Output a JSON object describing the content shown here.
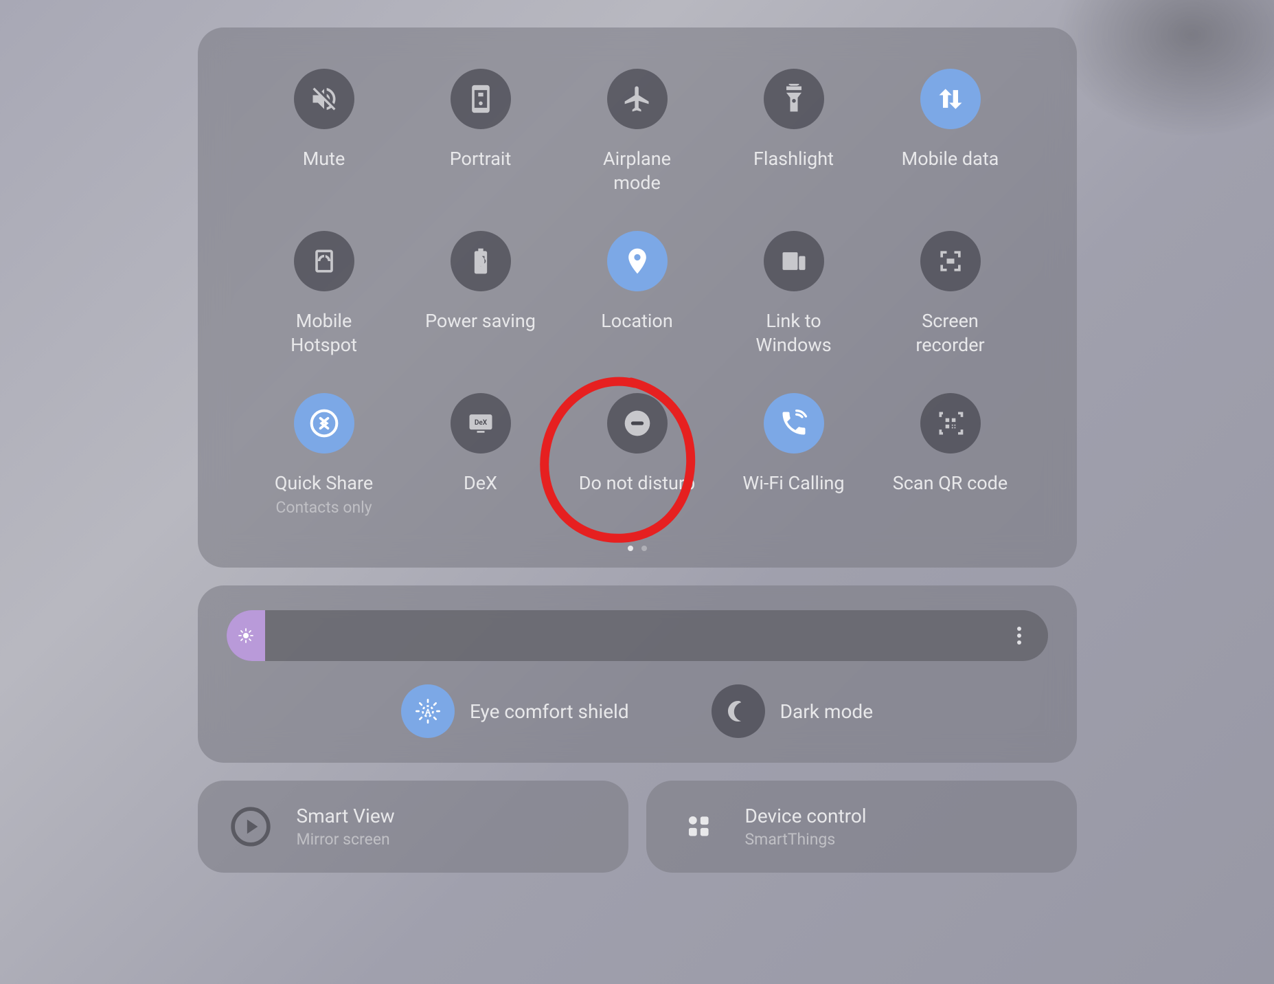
{
  "tiles": [
    {
      "label": "Mute",
      "active": false,
      "icon": "mute"
    },
    {
      "label": "Portrait",
      "active": false,
      "icon": "portrait"
    },
    {
      "label": "Airplane mode",
      "active": false,
      "icon": "airplane"
    },
    {
      "label": "Flashlight",
      "active": false,
      "icon": "flashlight"
    },
    {
      "label": "Mobile data",
      "active": true,
      "icon": "mobile-data"
    },
    {
      "label": "Mobile Hotspot",
      "active": false,
      "icon": "hotspot"
    },
    {
      "label": "Power saving",
      "active": false,
      "icon": "power-saving"
    },
    {
      "label": "Location",
      "active": true,
      "icon": "location"
    },
    {
      "label": "Link to Windows",
      "active": false,
      "icon": "link-windows"
    },
    {
      "label": "Screen recorder",
      "active": false,
      "icon": "screen-recorder"
    },
    {
      "label": "Quick Share",
      "sublabel": "Contacts only",
      "active": true,
      "icon": "quick-share"
    },
    {
      "label": "DeX",
      "active": false,
      "icon": "dex"
    },
    {
      "label": "Do not disturb",
      "active": false,
      "icon": "dnd",
      "annotated": true
    },
    {
      "label": "Wi-Fi Calling",
      "active": true,
      "icon": "wifi-calling"
    },
    {
      "label": "Scan QR code",
      "active": false,
      "icon": "qr"
    }
  ],
  "pagination": {
    "pages": 2,
    "current": 0
  },
  "brightness": {
    "percent": 5
  },
  "display_toggles": {
    "eye_comfort": {
      "label": "Eye comfort shield",
      "active": true
    },
    "dark_mode": {
      "label": "Dark mode",
      "active": false
    }
  },
  "bottom_cards": {
    "smart_view": {
      "title": "Smart View",
      "subtitle": "Mirror screen"
    },
    "device_control": {
      "title": "Device control",
      "subtitle": "SmartThings"
    }
  }
}
